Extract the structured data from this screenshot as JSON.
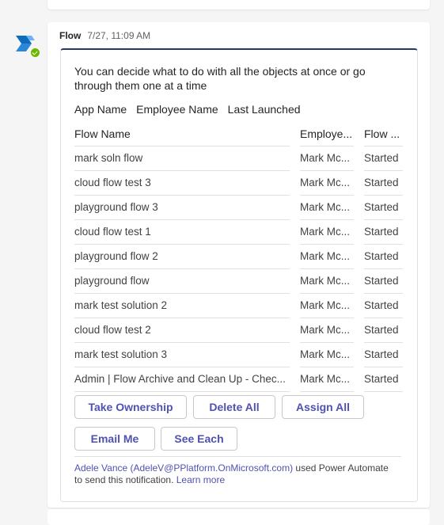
{
  "message": {
    "sender": "Flow",
    "timestamp": "7/27, 11:09 AM",
    "avatar_icon": "power-automate-icon",
    "presence_status": "available"
  },
  "card": {
    "intro_text": "You can decide what to do with all the objects at once or go through them one at a time",
    "facts": [
      "App Name",
      "Employee Name",
      "Last Launched"
    ],
    "table": {
      "columns": [
        "Flow Name",
        "Employe...",
        "Flow ..."
      ],
      "rows": [
        [
          "mark soln flow",
          "Mark Mc...",
          "Started"
        ],
        [
          "cloud flow test 3",
          "Mark Mc...",
          "Started"
        ],
        [
          "playground flow 3",
          "Mark Mc...",
          "Started"
        ],
        [
          "cloud flow test 1",
          "Mark Mc...",
          "Started"
        ],
        [
          "playground flow 2",
          "Mark Mc...",
          "Started"
        ],
        [
          "playground flow",
          "Mark Mc...",
          "Started"
        ],
        [
          "mark test solution 2",
          "Mark Mc...",
          "Started"
        ],
        [
          "cloud flow test 2",
          "Mark Mc...",
          "Started"
        ],
        [
          "mark test solution 3",
          "Mark Mc...",
          "Started"
        ],
        [
          "Admin | Flow Archive and Clean Up - Chec...",
          "Mark Mc...",
          "Started"
        ]
      ]
    },
    "actions": {
      "take_ownership": "Take Ownership",
      "delete_all": "Delete All",
      "assign_all": "Assign All",
      "email_me": "Email Me",
      "see_each": "See Each"
    },
    "footer": {
      "user_link": "Adele Vance (AdeleV@PPlatform.OnMicrosoft.com)",
      "middle_text": " used Power Automate to send this notification. ",
      "learn_more": "Learn more"
    }
  },
  "colors": {
    "accent": "#4f52b2",
    "card_top_border": "#243a5e",
    "presence": "#6bb700",
    "background": "#f5f5f5"
  }
}
